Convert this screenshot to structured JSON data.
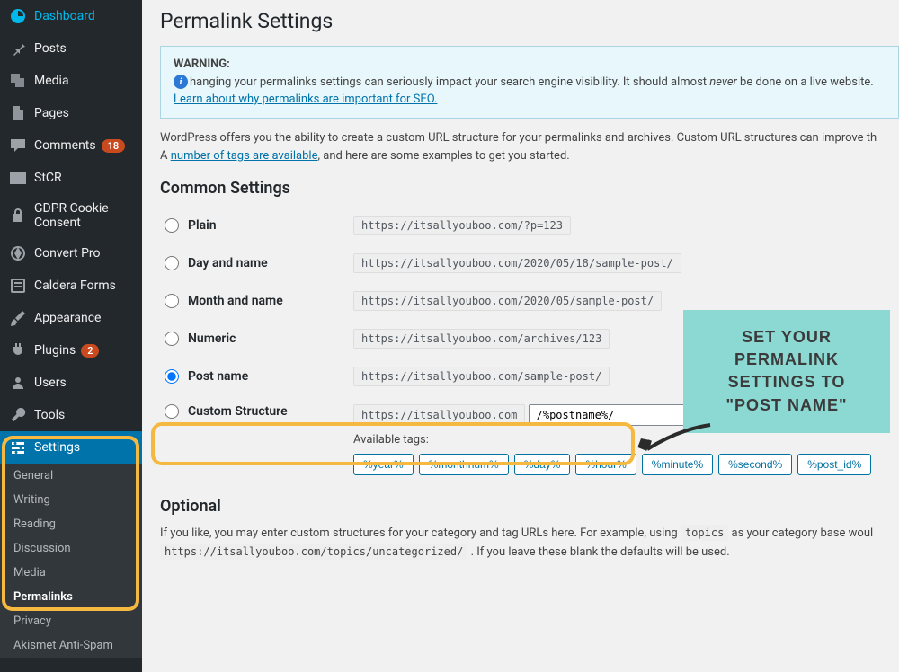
{
  "sidebar": {
    "items": [
      {
        "label": "Dashboard"
      },
      {
        "label": "Posts"
      },
      {
        "label": "Media"
      },
      {
        "label": "Pages"
      },
      {
        "label": "Comments",
        "badge": "18"
      },
      {
        "label": "StCR"
      },
      {
        "label": "GDPR Cookie Consent"
      },
      {
        "label": "Convert Pro"
      },
      {
        "label": "Caldera Forms"
      },
      {
        "label": "Appearance"
      },
      {
        "label": "Plugins",
        "badge": "2"
      },
      {
        "label": "Users"
      },
      {
        "label": "Tools"
      },
      {
        "label": "Settings"
      }
    ],
    "submenu": [
      {
        "label": "General"
      },
      {
        "label": "Writing"
      },
      {
        "label": "Reading"
      },
      {
        "label": "Discussion"
      },
      {
        "label": "Media"
      },
      {
        "label": "Permalinks"
      },
      {
        "label": "Privacy"
      },
      {
        "label": "Akismet Anti-Spam"
      }
    ]
  },
  "page": {
    "title": "Permalink Settings",
    "warning_label": "WARNING:",
    "warning_text_pre": "hanging your permalinks settings can seriously impact your search engine visibility. It should almost ",
    "warning_never": "never",
    "warning_text_post": " be done on a live website.",
    "warning_link": "Learn about why permalinks are important for SEO.",
    "intro_pre": "WordPress offers you the ability to create a custom URL structure for your permalinks and archives. Custom URL structures can improve th",
    "intro_a_pre": "A ",
    "intro_link": "number of tags are available",
    "intro_a_post": ", and here are some examples to get you started.",
    "common_heading": "Common Settings",
    "options": [
      {
        "label": "Plain",
        "url": "https://itsallyouboo.com/?p=123"
      },
      {
        "label": "Day and name",
        "url": "https://itsallyouboo.com/2020/05/18/sample-post/"
      },
      {
        "label": "Month and name",
        "url": "https://itsallyouboo.com/2020/05/sample-post/"
      },
      {
        "label": "Numeric",
        "url": "https://itsallyouboo.com/archives/123"
      },
      {
        "label": "Post name",
        "url": "https://itsallyouboo.com/sample-post/"
      },
      {
        "label": "Custom Structure"
      }
    ],
    "custom_prefix": "https://itsallyouboo.com",
    "custom_value": "/%postname%/",
    "available_tags_label": "Available tags:",
    "tags": [
      "%year%",
      "%monthnum%",
      "%day%",
      "%hour%",
      "%minute%",
      "%second%",
      "%post_id%"
    ],
    "optional_heading": "Optional",
    "optional_pre": "If you like, you may enter custom structures for your category and tag URLs here. For example, using ",
    "optional_code1": "topics",
    "optional_mid": " as your category base woul",
    "optional_code2": "https://itsallyouboo.com/topics/uncategorized/",
    "optional_post": " . If you leave these blank the defaults will be used.",
    "callout": "SET YOUR PERMALINK SETTINGS TO \"POST NAME\""
  }
}
